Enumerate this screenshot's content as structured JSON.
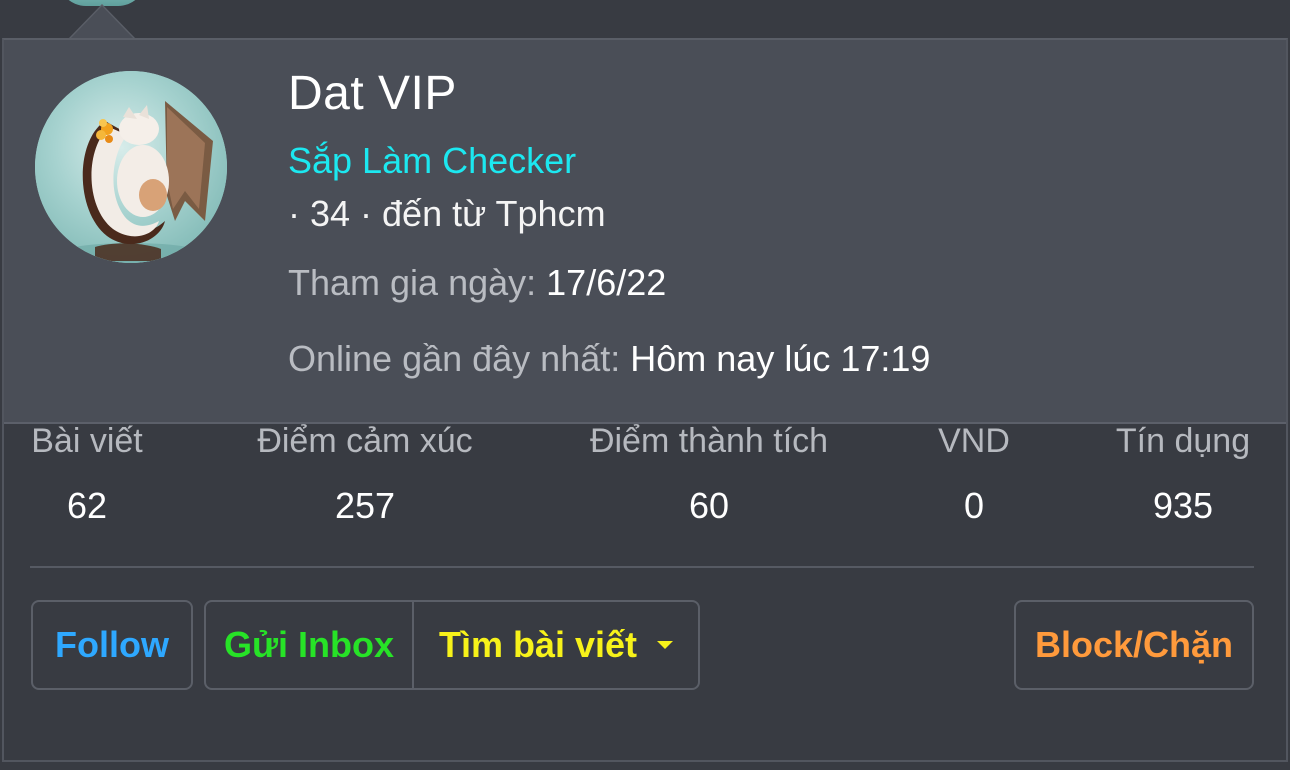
{
  "profile": {
    "username": "Dat VIP",
    "title": "Sắp Làm Checker",
    "meta": "· 34 · đến từ Tphcm",
    "joined_label": "Tham gia ngày:",
    "joined_value": "17/6/22",
    "online_label": "Online gần đây nhất:",
    "online_value": "Hôm nay lúc 17:19"
  },
  "stats": [
    {
      "label": "Bài viết",
      "value": "62"
    },
    {
      "label": "Điểm cảm xúc",
      "value": "257"
    },
    {
      "label": "Điểm thành tích",
      "value": "60"
    },
    {
      "label": "VND",
      "value": "0"
    },
    {
      "label": "Tín dụng",
      "value": "935"
    }
  ],
  "actions": {
    "follow": "Follow",
    "inbox": "Gửi Inbox",
    "search_posts": "Tìm bài viết",
    "block": "Block/Chặn"
  },
  "colors": {
    "title": "#1ce8f0",
    "follow": "#2ea8ff",
    "inbox": "#27e327",
    "search_posts": "#f7f21a",
    "block": "#ff9a3c"
  },
  "icons": {
    "avatar": "dragon-avatar",
    "dropdown": "caret-down-icon"
  }
}
